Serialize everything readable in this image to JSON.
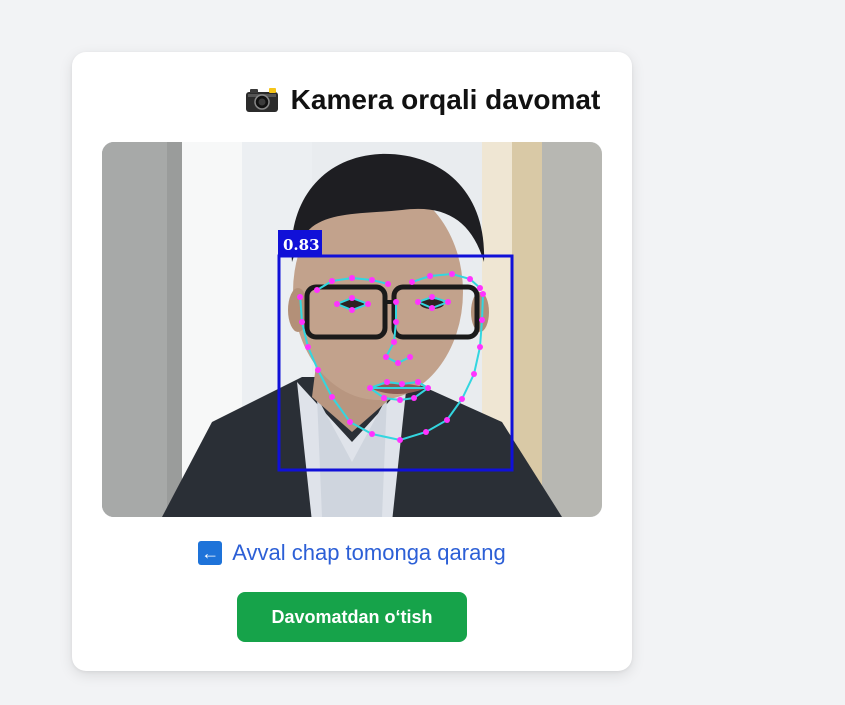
{
  "page": {
    "title": "Kamera orqali davomat",
    "title_icon": "camera-icon"
  },
  "camera": {
    "detection_score": "0.83",
    "box_color": "#1010d8",
    "landmark_color": "#ff33ff",
    "mesh_color": "#33d6e0"
  },
  "instruction": {
    "icon": "left-arrow-icon",
    "text": "Avval chap tomonga qarang",
    "color": "#2c5fd6"
  },
  "actions": {
    "skip_label": "Davomatdan o‘tish",
    "skip_color": "#16a34a"
  }
}
